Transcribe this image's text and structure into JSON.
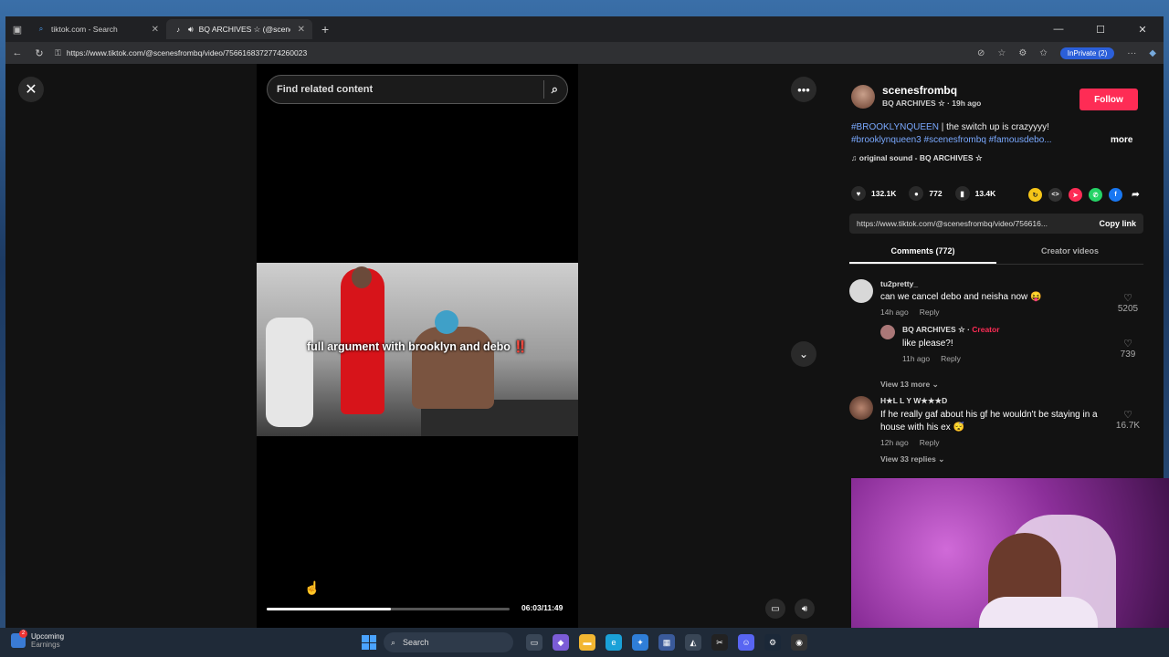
{
  "browser": {
    "tabs": [
      {
        "label": "tiktok.com - Search"
      },
      {
        "label": "BQ ARCHIVES ☆ (@scenesf"
      }
    ],
    "url": "https://www.tiktok.com/@scenesfrombq/video/7566168372774260023",
    "inprivate_label": "InPrivate (2)"
  },
  "player": {
    "search_placeholder": "Find related content",
    "caption": "full argument with brooklyn and debo",
    "caption_emoji": "‼️",
    "time": "06:03/11:49",
    "progress": 0.51
  },
  "post": {
    "username": "scenesfrombq",
    "nickname_line": "BQ ARCHIVES ☆ · 19h ago",
    "follow_label": "Follow",
    "desc_tag": "#BROOKLYNQUEEN",
    "desc_text": " | the switch up is crazyyyy!",
    "desc_tags_2": "#brooklynqueen3 #scenesfrombq #famousdebo...",
    "more_label": "more",
    "sound": "original sound - BQ ARCHIVES ☆",
    "likes": "132.1K",
    "comments": "772",
    "saves": "13.4K",
    "share_link": "https://www.tiktok.com/@scenesfrombq/video/756616...",
    "copy_link_label": "Copy link"
  },
  "tabs": {
    "comments": "Comments (772)",
    "creator": "Creator videos"
  },
  "comments": [
    {
      "user": "tu2pretty_",
      "text": "can we cancel debo and neisha now 😝",
      "time": "14h ago",
      "reply_label": "Reply",
      "likes": "5205",
      "reply": {
        "user": "BQ ARCHIVES ☆",
        "badge": "Creator",
        "text": "like please?!",
        "time": "11h ago",
        "reply_label": "Reply",
        "likes": "739"
      },
      "view_more": "View 13 more"
    },
    {
      "user": "H★L L Y W★★★D",
      "text": "If he really gaf about his gf he wouldn't be staying in a house with his ex 😴",
      "time": "12h ago",
      "reply_label": "Reply",
      "likes": "16.7K",
      "view_more": "View 33 replies"
    }
  ],
  "taskbar": {
    "weather_title": "Upcoming",
    "weather_sub": "Earnings",
    "weather_badge": "2",
    "search_label": "Search"
  }
}
